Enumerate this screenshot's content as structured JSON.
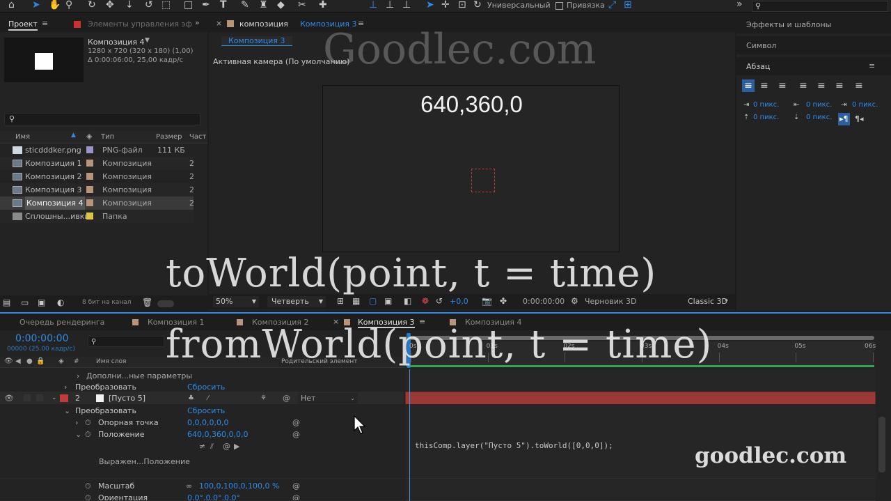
{
  "toolbar": {
    "universal_label": "Универсальный",
    "snapping_label": "Привязка",
    "icons": [
      "home-icon",
      "selection-arrow-icon",
      "hand-icon",
      "zoom-icon",
      "orbit-icon",
      "pan-icon",
      "dolly-icon",
      "rotate-icon",
      "region-icon",
      "rectangle-icon",
      "pen-icon",
      "text-icon",
      "brush-icon",
      "stamp-icon",
      "eraser-icon",
      "roto-icon",
      "pin-icon"
    ]
  },
  "project_panel": {
    "tab_label": "Проект",
    "effects_controls_tab": "Элементы управления эф",
    "comp_name": "Композиция 4",
    "comp_size": "1280 x 720  (320 x 180) (1,00)",
    "comp_duration": "Δ 0:00:06:00, 25,00 кадр/с",
    "columns": [
      "Имя",
      "Тип",
      "Размер",
      "Част"
    ],
    "items": [
      {
        "name": "sticdddker.png",
        "type": "PNG-файл",
        "size": "111 КБ",
        "extra": "",
        "color": "#9a94c8",
        "selected": false
      },
      {
        "name": "Композиция 1",
        "type": "Композиция",
        "size": "",
        "extra": "2",
        "color": "#b8957a",
        "selected": false
      },
      {
        "name": "Композиция 2",
        "type": "Композиция",
        "size": "",
        "extra": "2",
        "color": "#b8957a",
        "selected": false
      },
      {
        "name": "Композиция 3",
        "type": "Композиция",
        "size": "",
        "extra": "2",
        "color": "#b8957a",
        "selected": false
      },
      {
        "name": "Композиция 4",
        "type": "Композиция",
        "size": "",
        "extra": "2",
        "color": "#b8957a",
        "selected": true
      },
      {
        "name": "Сплошны...ивки",
        "type": "Папка",
        "size": "",
        "extra": "",
        "color": "#e2c43a",
        "selected": false
      }
    ],
    "bit_depth": "8 бит на канал"
  },
  "composition_panel": {
    "tab_prefix": "композиция",
    "tab_name": "Композиция 3",
    "breadcrumb": "Композиция 3",
    "camera_label": "Активная камера (По умолчанию)",
    "canvas_readout": "640,360,0",
    "zoom": "50%",
    "resolution": "Четверть",
    "exposure": "+0,0",
    "timecode": "0:00:00:00",
    "draft_label": "Черновик 3D",
    "renderer": "Classic 3D"
  },
  "right_panel": {
    "effects_label": "Эффекты и шаблоны",
    "symbol_label": "Символ",
    "paragraph_label": "Абзац",
    "indent_values": [
      "0 пикс.",
      "0 пикс.",
      "0 пикс.",
      "0 пикс.",
      "0 пикс."
    ]
  },
  "timeline": {
    "tabs": [
      "Очередь рендеринга",
      "Композиция 1",
      "Композиция 2",
      "Композиция 3",
      "Композиция 4"
    ],
    "active_tab_index": 3,
    "timecode": "0:00:00:00",
    "fps_note": "00000 (25.00 кадр/с)",
    "layer_name_header": "Имя слоя",
    "parent_header": "Родительский элемент",
    "ruler_labels": [
      "0s",
      "01s",
      "02s",
      "03s",
      "04s",
      "05s",
      "06s"
    ],
    "rows": {
      "extra_params": "Дополни...ные параметры",
      "transform1": "Преобразовать",
      "reset1": "Сбросить",
      "layer_num": "2",
      "layer_name": "[Пусто 5]",
      "parent_value": "Нет",
      "transform2": "Преобразовать",
      "reset2": "Сбросить",
      "anchor_label": "Опорная точка",
      "anchor_value": "0,0,0,0,0,0",
      "position_label": "Положение",
      "position_value": "640,0,360,0,0,0",
      "expression_label": "Выражен...Положение",
      "expression_code": "thisComp.layer(\"Пусто 5\").toWorld([0,0,0]);",
      "scale_label": "Масштаб",
      "scale_value": "100,0,100,0,100,0 %",
      "orientation_label": "Ориентация",
      "orientation_value": "0,0°,0,0°,0,0°"
    }
  },
  "overlay": {
    "watermark_top": "Goodlec.com",
    "line1": "toWorld(point, t = time)",
    "line2": "fromWorld(point, t = time)",
    "watermark_bottom": "goodlec.com"
  }
}
